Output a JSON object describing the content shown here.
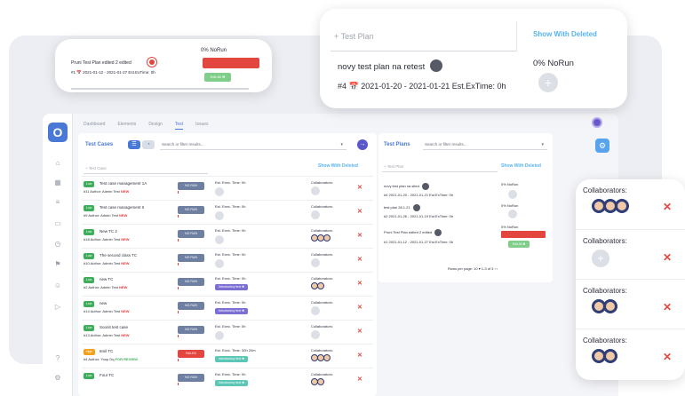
{
  "colors": {
    "accent": "#4a78d6",
    "danger": "#e2463f",
    "success": "#3fae5b",
    "info": "#58b4ee"
  },
  "tabs": [
    "Dashboard",
    "Elements",
    "Design",
    "Test",
    "Issues"
  ],
  "test_cases": {
    "title": "Test Cases",
    "search_placeholder": "Search or filter results...",
    "filter_placeholder": "+ Test Case",
    "show_deleted": "Show With Deleted",
    "rows": [
      {
        "priority": "Low",
        "name": "Test case management 1A",
        "meta": "#11 Author: Admin Test",
        "flag": "NEW",
        "status": "NO RUN",
        "est": "Est. Exec. Time: 0h",
        "collab_label": "Collaborators:"
      },
      {
        "priority": "Low",
        "name": "Test case management II",
        "meta": "#9 Author: Admin Test",
        "flag": "NEW",
        "status": "NO RUN",
        "est": "Est. Exec. Time: 0h",
        "collab_label": "Collaborators:"
      },
      {
        "priority": "Low",
        "name": "New TC 2",
        "meta": "#18 Author: Admin Test",
        "flag": "NEW",
        "status": "NO RUN",
        "est": "Est. Exec. Time: 0h",
        "collab_label": "Collaborators:"
      },
      {
        "priority": "Low",
        "name": "The second class TC",
        "meta": "#10 Author: Admin Test",
        "flag": "NEW",
        "status": "NO RUN",
        "est": "Est. Exec. Time: 0h",
        "collab_label": "Collaborators:"
      },
      {
        "priority": "Low",
        "name": "new TC",
        "meta": "#2 Author: Admin Test",
        "flag": "NEW",
        "status": "NO RUN",
        "est": "Est. Exec. Time: 0h",
        "collab_label": "Collaborators:"
      },
      {
        "priority": "Low",
        "name": "new",
        "meta": "#14 Author: Admin Test",
        "flag": "NEW",
        "status": "NO RUN",
        "est": "Est. Exec. Time: 0h",
        "collab_label": "Collaborators:"
      },
      {
        "priority": "Low",
        "name": "Soonit test case",
        "meta": "#13 Author: Admin Test",
        "flag": "NEW",
        "status": "NO RUN",
        "est": "Est. Exec. Time: 0h",
        "collab_label": "Collaborators:"
      },
      {
        "priority": "High",
        "name": "6mil TC",
        "meta": "#4 Author: Yoop Dq",
        "flag": "FOR REVIEW",
        "status": "FAILED",
        "est": "Est. Exec. Time: 30h 20m",
        "collab_label": "Collaborators:"
      },
      {
        "priority": "Low",
        "name": "Four TC",
        "meta": "",
        "flag": "",
        "status": "NO RUN",
        "est": "Est. Exec. Time: 0h",
        "collab_label": "Collaborators:"
      }
    ]
  },
  "test_plans": {
    "title": "Test Plans",
    "search_placeholder": "Search or filter results...",
    "filter_placeholder": "+ Test Plan",
    "show_deleted": "Show With Deleted",
    "plans": [
      {
        "name": "novy test plan na sited",
        "meta": "#4 2021-01-20 - 2021-01-21 Est.ExTime: 0h",
        "progress": "0% NoRun"
      },
      {
        "name": "test plan 26.1.21",
        "meta": "#2 2021-01-26 - 2021-01-19 Est.ExTime: 0h",
        "progress": "0% NoRun"
      },
      {
        "name": "Pruni Test Plan edited 2 edited",
        "meta": "#1 2021-01-12 - 2021-01-27 Est.ExTime: 0h",
        "progress": "0% NoRun"
      }
    ],
    "pager": "Rows per page: 10 ▾  1-3 of 3  ‹  ›"
  },
  "card1": {
    "title": "Pruni Test Plan edited 2 edited",
    "meta": "#1 📅 2021-01-12 - 2021-01-27 Est.ExTime: 0h",
    "progress": "0% NoRun",
    "button": "Edit All ✖"
  },
  "card2": {
    "search_placeholder": "+ Test Plan",
    "show_deleted": "Show With Deleted",
    "title": "novy test plan na retest",
    "meta": "#4 📅 2021-01-20 - 2021-01-21 Est.ExTime: 0h",
    "progress": "0% NoRun"
  },
  "card3": {
    "rows": [
      {
        "label": "Collaborators:",
        "type": "avatars",
        "count": 3
      },
      {
        "label": "Collaborators:",
        "type": "add",
        "count": 0
      },
      {
        "label": "Collaborators:",
        "type": "avatars",
        "count": 2
      },
      {
        "label": "Collaborators:",
        "type": "avatars",
        "count": 2
      }
    ]
  }
}
